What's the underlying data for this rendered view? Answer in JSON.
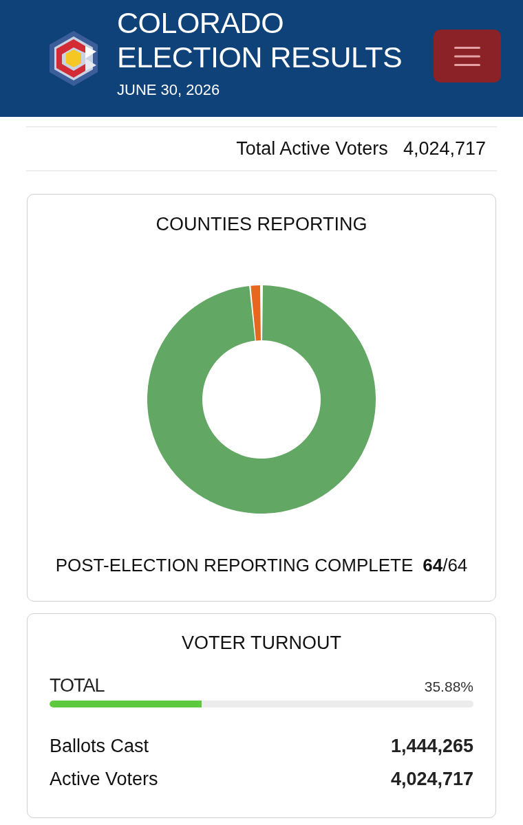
{
  "header": {
    "title_lines": [
      "COLORADO",
      "ELECTION RESULTS"
    ],
    "date": "JUNE 30, 2026"
  },
  "summary": {
    "label": "Total Active Voters",
    "value": "4,024,717"
  },
  "counties_card": {
    "title": "COUNTIES REPORTING",
    "status": "POST-ELECTION REPORTING COMPLETE",
    "count": "**64**/64"
  },
  "turnout_card": {
    "title": "VOTER TURNOUT",
    "total_label": "TOTAL",
    "percent": "35.88%",
    "level": 0.3588,
    "rows": [
      {
        "label": "Ballots Cast",
        "value": "1,444,265"
      },
      {
        "label": "Active Voters",
        "value": "4,024,717"
      }
    ]
  }
}
